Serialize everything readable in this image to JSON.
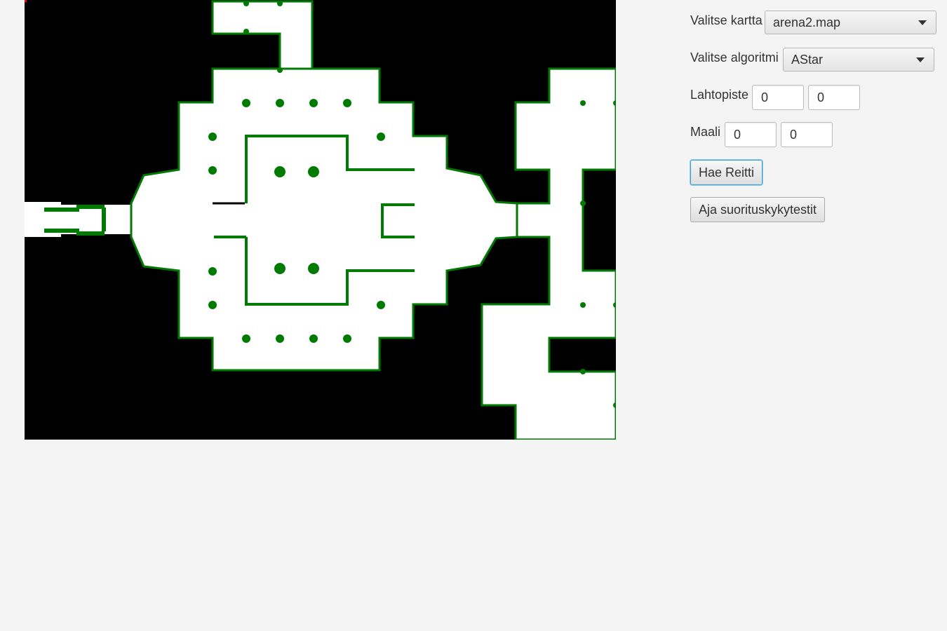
{
  "map": {
    "name": "arena2.map",
    "colors": {
      "wall": "#000000",
      "floor": "#ffffff",
      "edge": "#007a00",
      "path": "#000000",
      "marker": "#ff0000"
    }
  },
  "controls": {
    "map_label": "Valitse kartta",
    "map_value": "arena2.map",
    "algorithm_label": "Valitse algoritmi",
    "algorithm_value": "AStar",
    "start_label": "Lahtopiste",
    "start_x": "0",
    "start_y": "0",
    "goal_label": "Maali",
    "goal_x": "0",
    "goal_y": "0",
    "find_route_button": "Hae Reitti",
    "perf_test_button": "Aja suorituskykytestit"
  }
}
